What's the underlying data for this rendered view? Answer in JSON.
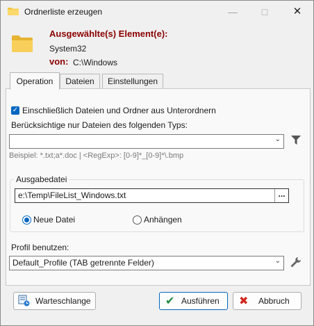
{
  "window": {
    "title": "Ordnerliste erzeugen"
  },
  "header": {
    "selected_heading": "Ausgewählte(s) Element(e):",
    "selected_name": "System32",
    "from_label": "von:",
    "from_path": "C:\\Windows"
  },
  "tabs": [
    {
      "label": "Operation",
      "active": true
    },
    {
      "label": "Dateien",
      "active": false
    },
    {
      "label": "Einstellungen",
      "active": false
    }
  ],
  "operation": {
    "include_subfolders_label": "Einschließlich Dateien und Ordner aus Unterordnern",
    "include_subfolders_checked": true,
    "filter_label": "Berücksichtige nur Dateien des folgenden Typs:",
    "filter_value": "",
    "filter_example": "Beispiel: *.txt;a*.doc | <RegExp>: [0-9]*_[0-9]*\\.bmp",
    "output_group_title": "Ausgabedatei",
    "output_path": "e:\\Temp\\FileList_Windows.txt",
    "browse_label": "...",
    "mode_options": [
      {
        "label": "Neue Datei",
        "selected": true
      },
      {
        "label": "Anhängen",
        "selected": false
      }
    ],
    "profile_label": "Profil benutzen:",
    "profile_value": "Default_Profile (TAB getrennte Felder)"
  },
  "buttons": {
    "queue": "Warteschlange",
    "run": "Ausführen",
    "cancel": "Abbruch"
  },
  "colors": {
    "heading_red": "#8b0000",
    "accent_blue": "#0067c0",
    "folder_yellow": "#f4c542"
  }
}
